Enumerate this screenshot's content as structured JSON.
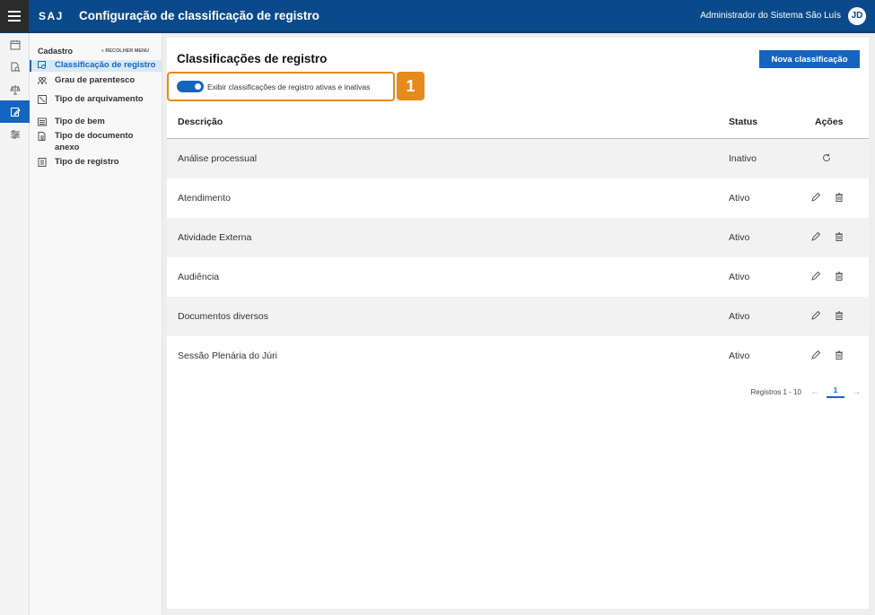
{
  "header": {
    "logo": "SAJ",
    "title": "Configuração de classificação de registro",
    "user_name": "Administrador do Sistema São Luís",
    "avatar_initials": "JD"
  },
  "rail": {
    "icons": [
      "calendar-icon",
      "document-search-icon",
      "scales-icon",
      "edit-document-icon",
      "sliders-icon"
    ],
    "active_index": 3
  },
  "submenu": {
    "title": "Cadastro",
    "collapse_label": "« RECOLHER MENU",
    "items": [
      {
        "label": "Classificação de registro",
        "icon": "classification-icon"
      },
      {
        "label": "Grau de parentesco",
        "icon": "people-icon"
      },
      {
        "label": "Tipo de arquivamento",
        "icon": "archive-icon"
      },
      {
        "label": "Tipo de bem",
        "icon": "list-icon"
      },
      {
        "label": "Tipo de documento anexo",
        "icon": "attachment-icon"
      },
      {
        "label": "Tipo de registro",
        "icon": "register-icon"
      }
    ],
    "active_index": 0
  },
  "main": {
    "title": "Classificações de registro",
    "new_button": "Nova classificação",
    "toggle_label": "Exibir classificações de registro ativas e inativas",
    "toggle_on": true,
    "callout_number": "1",
    "columns": {
      "description": "Descrição",
      "status": "Status",
      "actions": "Ações"
    },
    "rows": [
      {
        "description": "Análise processual",
        "status": "Inativo",
        "actions": [
          "restore-icon"
        ]
      },
      {
        "description": "Atendimento",
        "status": "Ativo",
        "actions": [
          "edit-icon",
          "delete-icon"
        ]
      },
      {
        "description": "Atividade Externa",
        "status": "Ativo",
        "actions": [
          "edit-icon",
          "delete-icon"
        ]
      },
      {
        "description": "Audiência",
        "status": "Ativo",
        "actions": [
          "edit-icon",
          "delete-icon"
        ]
      },
      {
        "description": "Documentos diversos",
        "status": "Ativo",
        "actions": [
          "edit-icon",
          "delete-icon"
        ]
      },
      {
        "description": "Sessão Plenária do Júri",
        "status": "Ativo",
        "actions": [
          "edit-icon",
          "delete-icon"
        ]
      }
    ],
    "pagination": {
      "range": "Registros 1 - 10",
      "current_page": "1"
    }
  },
  "colors": {
    "primary": "#1565c0",
    "header": "#0b4a8a",
    "callout": "#e68a1c"
  }
}
